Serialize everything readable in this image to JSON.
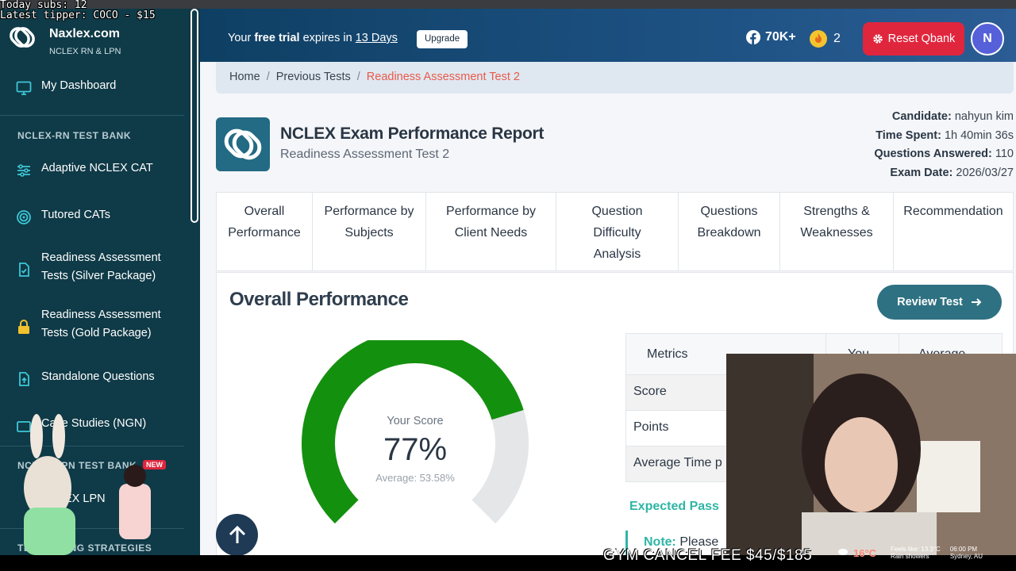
{
  "overlay": {
    "today_subs": "Today subs: 12",
    "latest_tipper": "Latest tipper: COCO - $15",
    "ticker": "GYM CANCEL FEE $45/$185",
    "weather": {
      "temp": "16°C",
      "feels": "Feels like: 13.3°C",
      "desc": "Rain showers",
      "time": "06:00 PM",
      "place": "Sydney, AU"
    }
  },
  "sidebar": {
    "brand_title": "Naxlex.com",
    "brand_sub": "NCLEX RN & LPN",
    "dashboard": "My Dashboard",
    "section_rn": "NCLEX-RN TEST BANK",
    "items": [
      {
        "label": "Adaptive NCLEX CAT",
        "icon": "sliders-icon"
      },
      {
        "label": "Tutored CATs",
        "icon": "target-icon"
      },
      {
        "label": "Readiness Assessment Tests (Silver Package)",
        "icon": "clipboard-check-icon"
      },
      {
        "label": "Readiness Assessment Tests (Gold Package)",
        "icon": "lock-icon"
      },
      {
        "label": "Standalone Questions",
        "icon": "file-upload-icon"
      },
      {
        "label": "Case Studies (NGN)",
        "icon": "case-icon"
      }
    ],
    "section_lpn": "NCLEX-LPN TEST BANK",
    "new_badge": "NEW",
    "lpn_item": "NCLEX LPN",
    "section_strategy": "TEST TAKING STRATEGIES"
  },
  "header": {
    "trial_prefix": "Your ",
    "trial_bold": "free trial",
    "trial_mid": " expires in ",
    "trial_days": "13 Days",
    "upgrade": "Upgrade",
    "fb_count": "70K+",
    "streak": "2",
    "reset_label": "Reset Qbank",
    "avatar_letter": "N"
  },
  "breadcrumb": {
    "home": "Home",
    "previous": "Previous Tests",
    "current": "Readiness Assessment Test 2"
  },
  "report": {
    "title": "NCLEX Exam Performance Report",
    "subtitle": "Readiness Assessment Test 2",
    "candidate_label": "Candidate:",
    "candidate": "nahyun kim",
    "time_label": "Time Spent:",
    "time": "1h 40min 36s",
    "answered_label": "Questions Answered:",
    "answered": "110",
    "date_label": "Exam Date:",
    "date": "2026/03/27"
  },
  "tabs": [
    {
      "l1": "Overall",
      "l2": "Performance",
      "l3": ""
    },
    {
      "l1": "Performance by",
      "l2": "Subjects",
      "l3": ""
    },
    {
      "l1": "Performance by",
      "l2": "Client Needs",
      "l3": ""
    },
    {
      "l1": "Question",
      "l2": "Difficulty",
      "l3": "Analysis"
    },
    {
      "l1": "Questions",
      "l2": "Breakdown",
      "l3": ""
    },
    {
      "l1": "Strengths &",
      "l2": "Weaknesses",
      "l3": ""
    },
    {
      "l1": "Recommendation",
      "l2": "",
      "l3": ""
    }
  ],
  "panel": {
    "title": "Overall Performance",
    "review_label": "Review Test",
    "score_label": "Your Score",
    "score_value": "77%",
    "score_fraction": 0.77,
    "average_label": "Average: 53.58%",
    "colors": {
      "score": "#14900f",
      "track": "#e5e6e8"
    },
    "table_headers": [
      "Metrics",
      "You",
      "Average"
    ],
    "table_rows": [
      "Score",
      "Points",
      "Average Time p"
    ],
    "expected": "Expected Pass",
    "note_bold": "Note:",
    "note_text": " Please"
  }
}
